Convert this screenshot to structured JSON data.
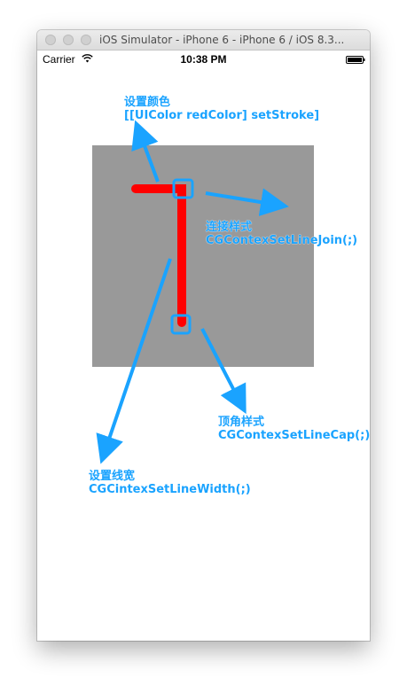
{
  "window": {
    "title": "iOS Simulator - iPhone 6 - iPhone 6 / iOS 8.3..."
  },
  "statusbar": {
    "carrier": "Carrier",
    "time": "10:38 PM",
    "wifi_icon": "wifi-icon",
    "battery_icon": "battery-icon"
  },
  "canvas": {
    "square_color": "#999999",
    "line_color": "#ff0000",
    "annotation_color": "#1aa3ff"
  },
  "annotations": {
    "set_color": {
      "title": "设置颜色",
      "code": "[[UIColor redColor] setStroke]"
    },
    "line_join": {
      "title": "连接样式",
      "code": "CGContexSetLineJoin(;)"
    },
    "line_cap": {
      "title": "顶角样式",
      "code": "CGContexSetLineCap(;)"
    },
    "line_width": {
      "title": "设置线宽",
      "code": "CGCintexSetLineWidth(;)"
    }
  }
}
